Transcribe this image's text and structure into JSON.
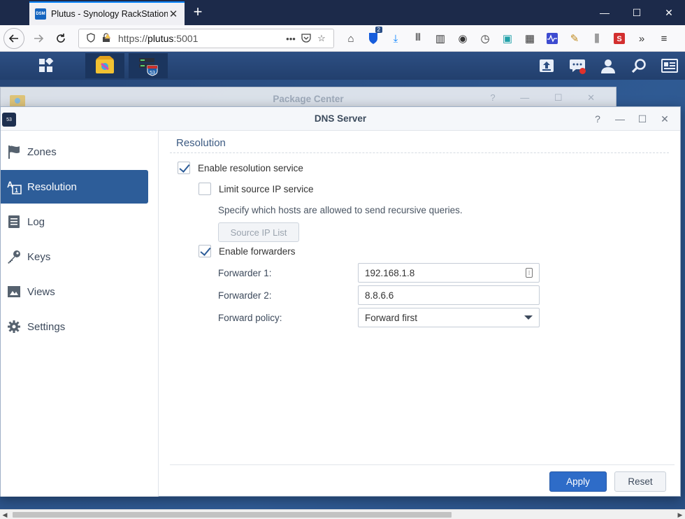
{
  "browser": {
    "tab": {
      "favicon_text": "DSM",
      "title": "Plutus - Synology RackStation",
      "close": "✕"
    },
    "new_tab": "+",
    "window_controls": {
      "minimize": "—",
      "maximize": "☐",
      "close": "✕"
    },
    "url": {
      "prefix": "https://",
      "host": "plutus",
      "suffix": ":5001"
    },
    "toolbar_badge": "2"
  },
  "dsm": {
    "taskbar_icons": [
      "main-menu-icon",
      "package-center-icon",
      "dns-server-icon"
    ]
  },
  "background_window": {
    "title": "Package Center",
    "controls": "? — ☐ ✕"
  },
  "dns_window": {
    "title": "DNS Server",
    "app_icon_text": "53",
    "controls": {
      "help": "?",
      "minimize": "—",
      "maximize": "☐",
      "close": "✕"
    },
    "sidebar": [
      {
        "label": "Zones",
        "icon": "flag-icon",
        "active": false
      },
      {
        "label": "Resolution",
        "icon": "resolution-icon",
        "active": true
      },
      {
        "label": "Log",
        "icon": "log-icon",
        "active": false
      },
      {
        "label": "Keys",
        "icon": "key-icon",
        "active": false
      },
      {
        "label": "Views",
        "icon": "views-icon",
        "active": false
      },
      {
        "label": "Settings",
        "icon": "gear-icon",
        "active": false
      }
    ],
    "content": {
      "section_title": "Resolution",
      "enable_resolution": {
        "label": "Enable resolution service",
        "checked": true
      },
      "limit_source_ip": {
        "label": "Limit source IP service",
        "checked": false
      },
      "description": "Specify which hosts are allowed to send recursive queries.",
      "source_ip_button": "Source IP List",
      "enable_forwarders": {
        "label": "Enable forwarders",
        "checked": true
      },
      "forwarder1": {
        "label": "Forwarder 1:",
        "value": "192.168.1.8"
      },
      "forwarder2": {
        "label": "Forwarder 2:",
        "value": "8.8.6.6"
      },
      "forward_policy": {
        "label": "Forward policy:",
        "value": "Forward first"
      },
      "apply_button": "Apply",
      "reset_button": "Reset"
    }
  },
  "colors": {
    "accent": "#2d5d99",
    "apply": "#2e6cc8",
    "desktop": "#2a4f84",
    "notification": "#e0312b"
  }
}
